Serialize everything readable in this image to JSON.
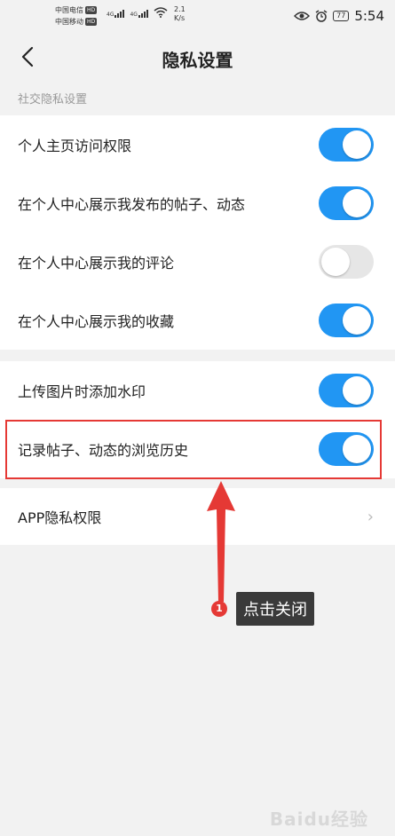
{
  "statusbar": {
    "carrier1": "中国电信",
    "carrier2": "中国移动",
    "hd": "HD",
    "net1": "4G",
    "net2": "4G",
    "speed_value": "2.1",
    "speed_unit": "K/s",
    "battery": "77",
    "time": "5:54"
  },
  "navbar": {
    "title": "隐私设置"
  },
  "section": {
    "label": "社交隐私设置"
  },
  "group1": {
    "items": [
      {
        "label": "个人主页访问权限",
        "on": true
      },
      {
        "label": "在个人中心展示我发布的帖子、动态",
        "on": true
      },
      {
        "label": "在个人中心展示我的评论",
        "on": false
      },
      {
        "label": "在个人中心展示我的收藏",
        "on": true
      }
    ]
  },
  "group2": {
    "items": [
      {
        "label": "上传图片时添加水印",
        "on": true
      },
      {
        "label": "记录帖子、动态的浏览历史",
        "on": true
      }
    ]
  },
  "group3": {
    "app_privacy_label": "APP隐私权限"
  },
  "annotation": {
    "step_number": "1",
    "callout_text": "点击关闭",
    "highlight_color": "#e53935"
  },
  "colors": {
    "toggle_on": "#2196f3",
    "toggle_off": "#e6e6e6",
    "background": "#f2f2f2"
  },
  "watermark": "Baidu经验"
}
